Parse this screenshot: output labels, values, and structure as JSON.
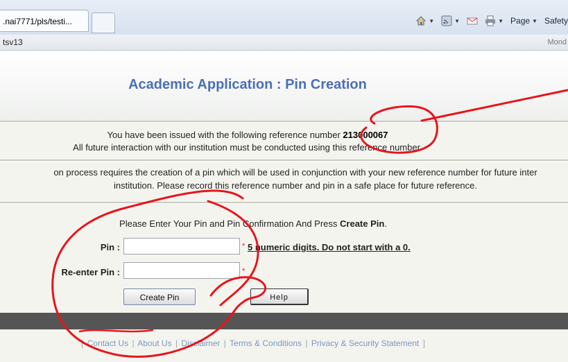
{
  "browser": {
    "tab_title": ".nai7771/pls/testi...",
    "toolbar": {
      "home_icon": "home-icon",
      "feeds_icon": "feeds-icon",
      "mail_icon": "mail-icon",
      "print_icon": "print-icon",
      "page_label": "Page",
      "safety_label": "Safety"
    },
    "site_tab": "tsv13",
    "date_fragment": "Mond"
  },
  "page": {
    "title": "Academic Application : Pin Creation",
    "reference": {
      "line1_prefix": "You have been issued with the following reference number",
      "number": "213000067",
      "line2": "All future interaction with our institution must be conducted using this reference number."
    },
    "info": {
      "line1": "on process requires the creation of a pin which will be used in conjunction with your new reference number for future inter",
      "line2": "institution. Please record this reference number and pin in a safe place for future reference."
    },
    "instruction": {
      "text": "Please Enter Your Pin and Pin Confirmation And Press",
      "emphasis": "Create Pin"
    },
    "form": {
      "pin_label": "Pin :",
      "pin_value": "",
      "reenter_label": "Re-enter Pin :",
      "reenter_value": "",
      "required_mark": "*",
      "pin_hint": "5 numeric digits. Do not start with a 0."
    },
    "buttons": {
      "create": "Create Pin",
      "help": "Help"
    },
    "footer": {
      "open_bracket": "[",
      "close_bracket": "]",
      "separator": "|",
      "links": [
        "Contact Us",
        "About Us",
        "Disclaimer",
        "Terms & Conditions",
        "Privacy & Security Statement"
      ]
    }
  },
  "colors": {
    "title": "#4b6fb7",
    "footer_bar": "#555555",
    "footer_links": "#7a97c2",
    "annotation": "#e8141b"
  }
}
